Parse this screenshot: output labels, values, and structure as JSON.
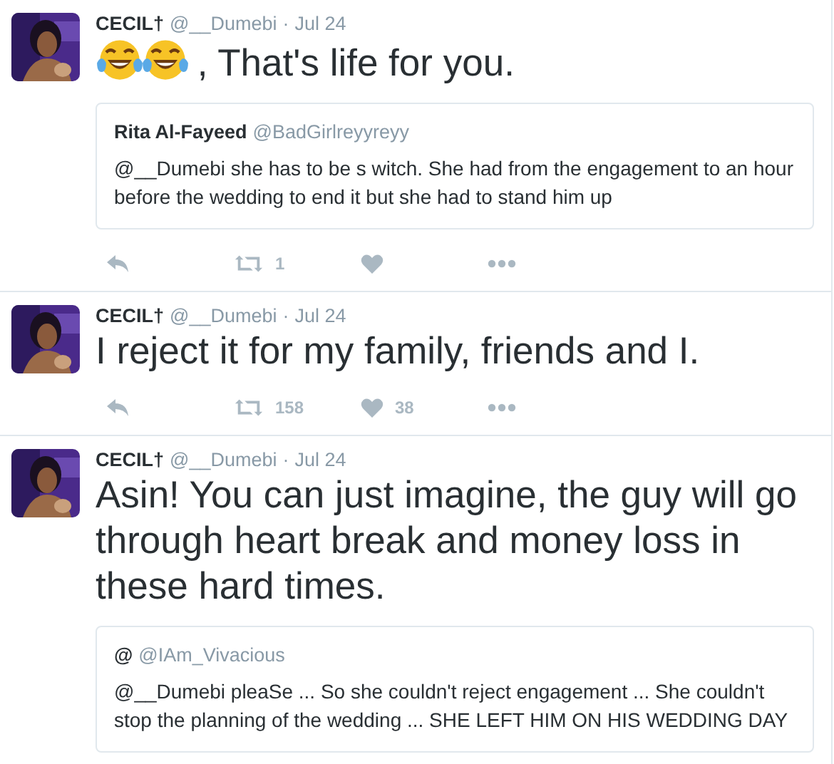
{
  "tweets": [
    {
      "name": "CECIL†",
      "handle": "@__Dumebi",
      "separator": "·",
      "date": "Jul 24",
      "kind": "emoji-text",
      "text": ", That's life for you.",
      "quote": {
        "name": "Rita Al-Fayeed",
        "handle": "@BadGirlreyyreyy",
        "text": "@__Dumebi she has to be s witch. She had from the engagement to an hour before the wedding to end it but she had to stand him up"
      },
      "retweets": "1"
    },
    {
      "name": "CECIL†",
      "handle": "@__Dumebi",
      "separator": "·",
      "date": "Jul 24",
      "kind": "text",
      "text": "I reject it for my family, friends and I.",
      "retweets": "158",
      "likes": "38"
    },
    {
      "name": "CECIL†",
      "handle": "@__Dumebi",
      "separator": "·",
      "date": "Jul 24",
      "kind": "text",
      "text": "Asin! You can just imagine, the guy will go through heart break and money loss in these hard times.",
      "quote": {
        "name": "@",
        "handle": "@IAm_Vivacious",
        "text": "@__Dumebi pleaSe ... So she couldn't reject engagement ... She couldn't stop the planning of the wedding ... SHE LEFT HIM ON HIS WEDDING DAY"
      }
    }
  ]
}
